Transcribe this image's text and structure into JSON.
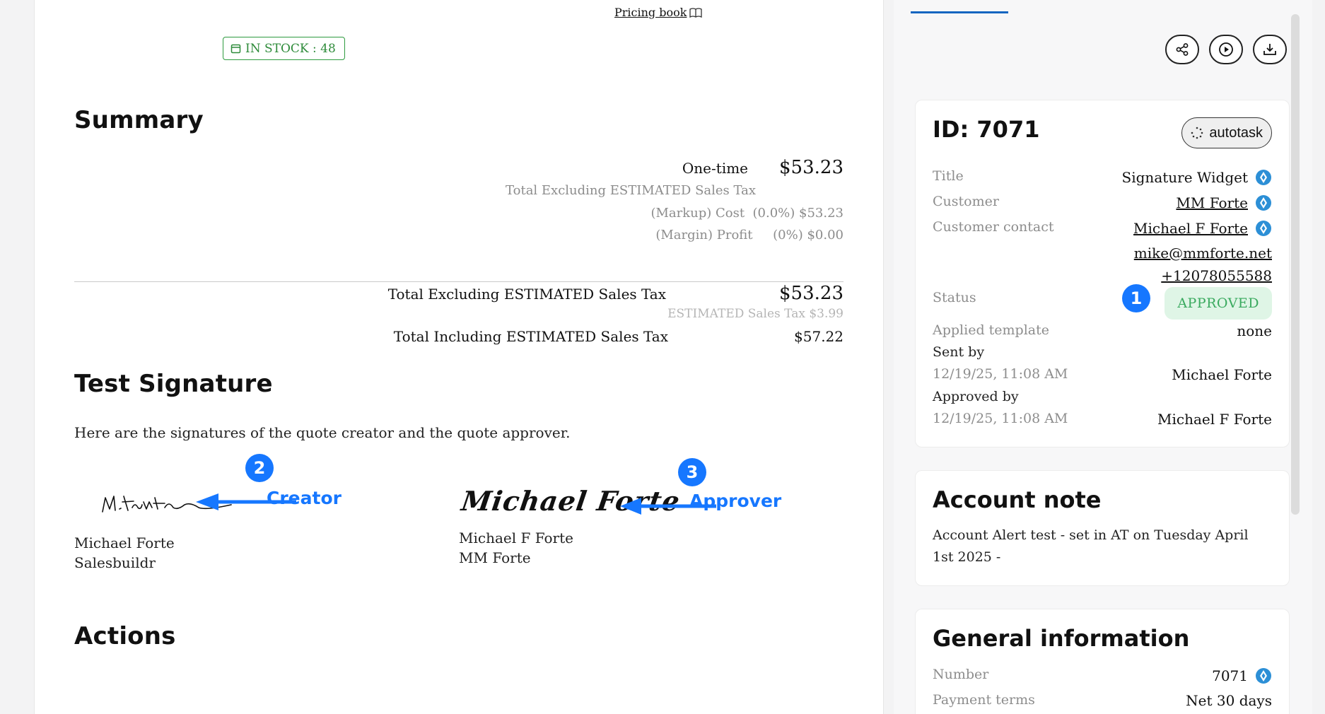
{
  "pricing_book": {
    "label": "Pricing book",
    "icon": "book-icon"
  },
  "stock": {
    "label": "IN STOCK : 48",
    "icon": "calendar-icon",
    "color": "#2e8b3a"
  },
  "summary": {
    "heading": "Summary",
    "one_time_label": "One-time",
    "one_time_value": "$53.23",
    "excl_tax_note": "Total Excluding ESTIMATED Sales Tax",
    "markup_cost": "(Markup) Cost  (0.0%) $53.23",
    "margin_profit": "(Margin) Profit     (0%) $0.00",
    "total_excl_label": "Total Excluding ESTIMATED Sales Tax",
    "total_excl_value": "$53.23",
    "est_tax": "ESTIMATED Sales Tax $3.99",
    "total_incl_label": "Total Including ESTIMATED Sales Tax",
    "total_incl_value": "$57.22"
  },
  "signature": {
    "heading": "Test Signature",
    "description": "Here are the signatures of the quote creator and the quote approver.",
    "creator": {
      "name": "Michael Forte",
      "company": "Salesbuildr",
      "annotation_num": "2",
      "annotation_label": "Creator"
    },
    "approver": {
      "signature_text": "Michael Forte",
      "name": "Michael F Forte",
      "company": "MM Forte",
      "annotation_num": "3",
      "annotation_label": "Approver"
    }
  },
  "actions": {
    "heading": "Actions"
  },
  "side": {
    "toolbar": [
      {
        "name": "share-icon"
      },
      {
        "name": "play-icon"
      },
      {
        "name": "download-icon"
      }
    ],
    "details": {
      "id_label": "ID: 7071",
      "autotask_label": "autotask",
      "title_label": "Title",
      "title_value": "Signature Widget",
      "customer_label": "Customer",
      "customer_value": "MM Forte",
      "contact_label": "Customer contact",
      "contact_value": "Michael F Forte",
      "contact_email": "mike@mmforte.net",
      "contact_phone": "+12078055588",
      "status_label": "Status",
      "status_value": "APPROVED",
      "status_annotation": "1",
      "template_label": "Applied template",
      "template_value": "none",
      "sent_by_label": "Sent by",
      "sent_by_date": "12/19/25, 11:08 AM",
      "sent_by_name": "Michael Forte",
      "approved_by_label": "Approved by",
      "approved_by_date": "12/19/25, 11:08 AM",
      "approved_by_name": "Michael F Forte"
    },
    "account_note": {
      "title": "Account note",
      "text": "Account Alert test - set in AT on Tuesday April 1st 2025 -"
    },
    "general": {
      "title": "General information",
      "number_label": "Number",
      "number_value": "7071",
      "terms_label": "Payment terms",
      "terms_value": "Net 30 days"
    }
  },
  "colors": {
    "accent": "#1677ff",
    "status_bg": "#dff5e6",
    "status_fg": "#3aaa5f",
    "tab": "#1565c0"
  }
}
